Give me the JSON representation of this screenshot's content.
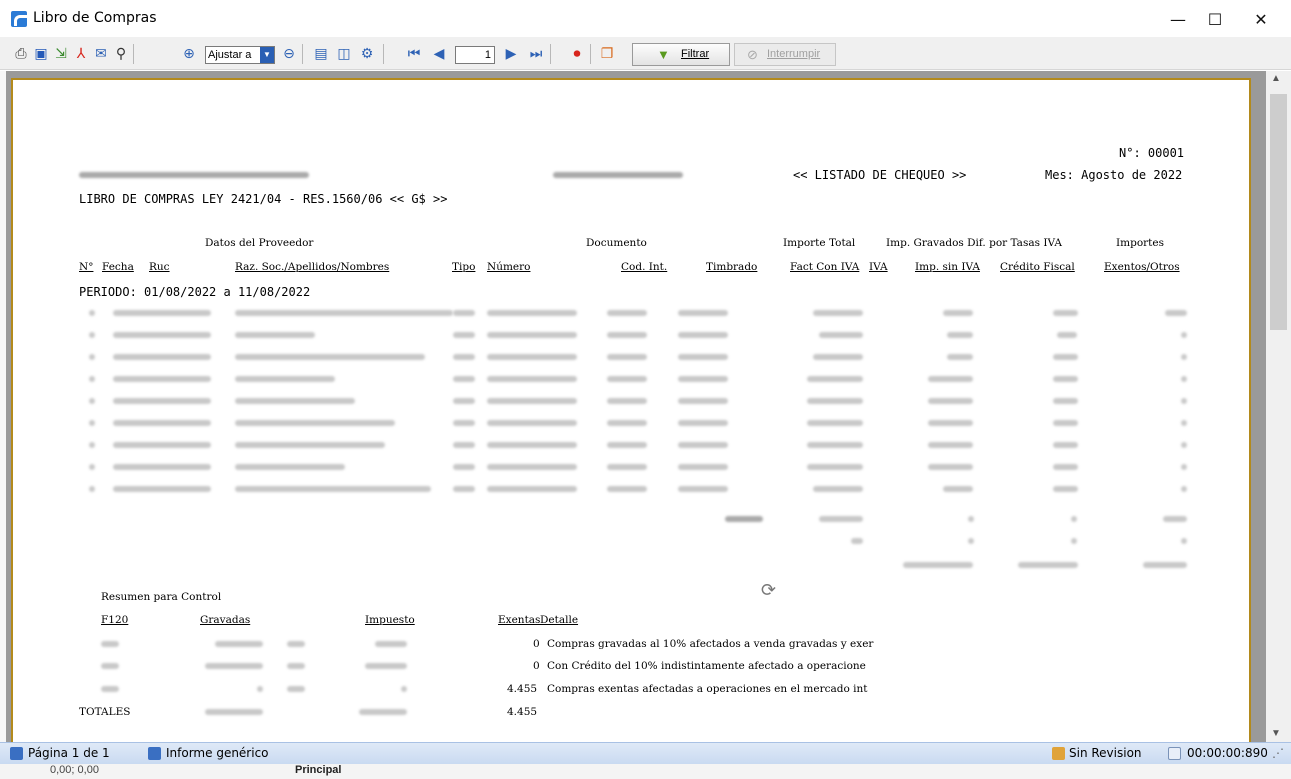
{
  "window": {
    "title": "Libro de Compras",
    "minimize": "—",
    "maximize": "☐",
    "close": "✕"
  },
  "toolbar": {
    "zoom_value": "Ajustar a",
    "page_value": "1",
    "filter_label": "Filtrar",
    "stop_label": "Interrumpir"
  },
  "report": {
    "number": "N°: 00001",
    "title": "<< LISTADO DE CHEQUEO >>",
    "month": "Mes: Agosto de 2022",
    "subtitle": "LIBRO DE COMPRAS LEY 2421/04 - RES.1560/06 << G$ >>",
    "group_headers": {
      "proveedor": "Datos del Proveedor",
      "documento": "Documento",
      "importe_total": "Importe Total",
      "gravados": "Imp. Gravados Dif. por Tasas IVA",
      "importes": "Importes"
    },
    "columns": {
      "n": "N°",
      "fecha": "Fecha",
      "ruc": "Ruc",
      "razon": "Raz. Soc./Apellidos/Nombres",
      "tipo": "Tipo",
      "numero": "Número",
      "cod_int": "Cod. Int.",
      "timbrado": "Timbrado",
      "fact_con_iva": "Fact Con IVA",
      "iva": "IVA",
      "imp_sin_iva": "Imp. sin IVA",
      "credito_fiscal": "Crédito Fiscal",
      "exentos": "Exentos/Otros"
    },
    "periodo": "PERIODO: 01/08/2022 a 11/08/2022",
    "summary": {
      "title": "Resumen para Control",
      "headers": {
        "f120": "F120",
        "gravadas": "Gravadas",
        "impuesto": "Impuesto",
        "exentas": "Exentas",
        "detalle": "Detalle"
      },
      "rows": [
        {
          "exentas": "0",
          "detalle": "Compras gravadas al 10% afectados a venda gravadas y exer"
        },
        {
          "exentas": "0",
          "detalle": "Con Crédito del 10% indistintamente afectado a operacione"
        },
        {
          "exentas": "4.455",
          "detalle": "Compras exentas afectadas a operaciones en el mercado int"
        }
      ],
      "totales_label": "TOTALES",
      "totales_exentas": "4.455"
    }
  },
  "status": {
    "page": "Página 1 de 1",
    "report_type": "Informe genérico",
    "revision": "Sin Revision",
    "timer": "00:00:00:890"
  },
  "bottom": {
    "coords": "0,00; 0,00",
    "tab": "Principal"
  },
  "colors": {
    "sheet_border": "#b38a1c",
    "status_bg": "#c9daf1",
    "viewer_bg": "#9a9a9a"
  }
}
